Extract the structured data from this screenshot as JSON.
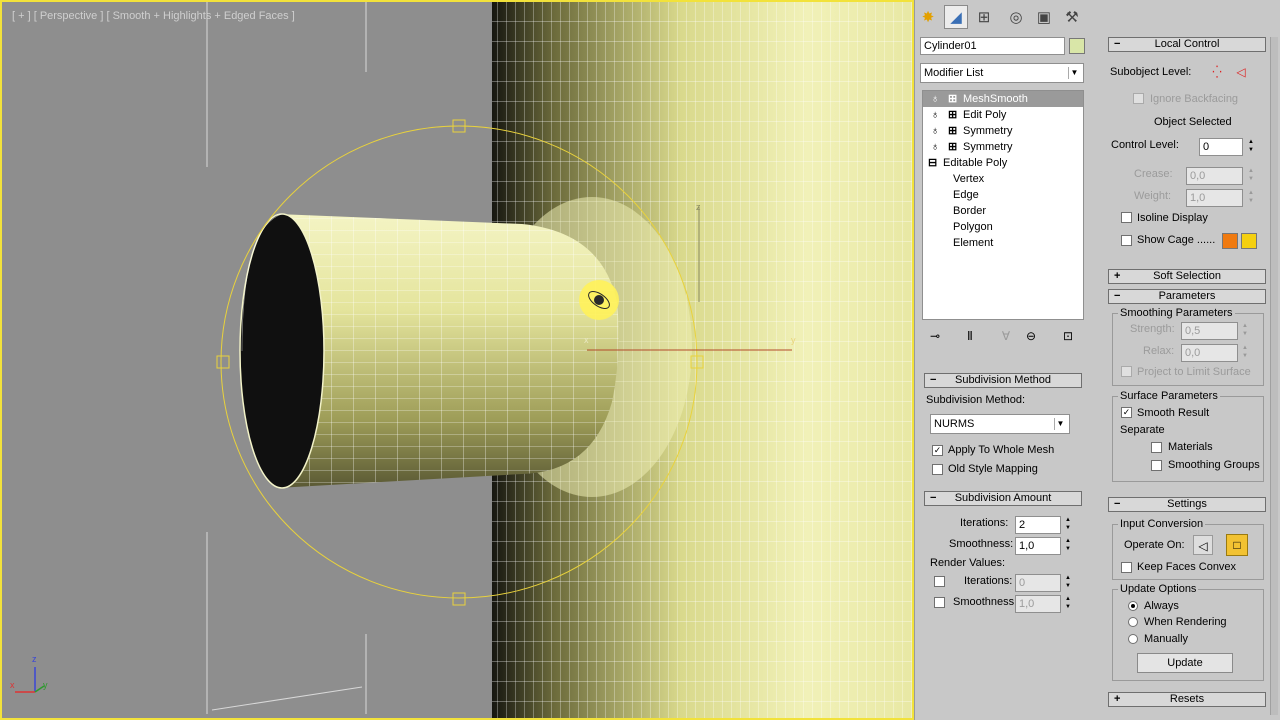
{
  "viewport": {
    "label": "[ + ] [ Perspective ] [ Smooth + Highlights + Edged Faces ]",
    "axis_y": "y",
    "axis_x": "x",
    "axis_z": "z",
    "triad": {
      "z": "z",
      "x": "x",
      "y": "y"
    }
  },
  "toolbar": {
    "tabs": [
      {
        "name": "create-icon",
        "glyph": "✸"
      },
      {
        "name": "modify-icon",
        "glyph": "◢"
      },
      {
        "name": "hierarchy-icon",
        "glyph": "⊞"
      },
      {
        "name": "motion-icon",
        "glyph": "◎"
      },
      {
        "name": "display-icon",
        "glyph": "▣"
      },
      {
        "name": "utilities-icon",
        "glyph": "⚒"
      }
    ]
  },
  "object": {
    "name": "Cylinder01",
    "color": "#d9e6a8"
  },
  "modifier_list": {
    "label": "Modifier List"
  },
  "stack": {
    "items": [
      {
        "label": "MeshSmooth",
        "selected": true
      },
      {
        "label": "Edit Poly"
      },
      {
        "label": "Symmetry"
      },
      {
        "label": "Symmetry"
      },
      {
        "label": "Editable Poly"
      }
    ],
    "sub_items": [
      "Vertex",
      "Edge",
      "Border",
      "Polygon",
      "Element"
    ]
  },
  "subdivision_method": {
    "header": "Subdivision Method",
    "label": "Subdivision Method:",
    "value": "NURMS",
    "apply_whole_mesh": "Apply To Whole Mesh",
    "old_style_mapping": "Old Style Mapping"
  },
  "subdivision_amount": {
    "header": "Subdivision Amount",
    "iterations_label": "Iterations:",
    "iterations": "2",
    "smoothness_label": "Smoothness:",
    "smoothness": "1,0",
    "render_values": "Render Values:",
    "r_iterations_label": "Iterations:",
    "r_iterations": "0",
    "r_smoothness_label": "Smoothness:",
    "r_smoothness": "1,0"
  },
  "local_control": {
    "header": "Local Control",
    "subobject_level": "Subobject Level:",
    "ignore_backfacing": "Ignore Backfacing",
    "object_selected": "Object Selected",
    "control_level_label": "Control Level:",
    "control_level": "0",
    "crease_label": "Crease:",
    "crease": "0,0",
    "weight_label": "Weight:",
    "weight": "1,0",
    "isoline_display": "Isoline Display",
    "show_cage": "Show Cage ......",
    "cage_color1": "#f07a10",
    "cage_color2": "#f5d010"
  },
  "soft_selection": {
    "header": "Soft Selection"
  },
  "parameters": {
    "header": "Parameters",
    "smoothing_parameters": "Smoothing Parameters",
    "strength_label": "Strength:",
    "strength": "0,5",
    "relax_label": "Relax:",
    "relax": "0,0",
    "project_limit": "Project to Limit Surface",
    "surface_parameters": "Surface Parameters",
    "smooth_result": "Smooth Result",
    "separate": "Separate",
    "materials": "Materials",
    "smoothing_groups": "Smoothing Groups"
  },
  "settings": {
    "header": "Settings",
    "input_conversion": "Input Conversion",
    "operate_on": "Operate On:",
    "keep_faces_convex": "Keep Faces Convex",
    "update_options": "Update Options",
    "always": "Always",
    "when_rendering": "When Rendering",
    "manually": "Manually",
    "update_button": "Update"
  },
  "resets": {
    "header": "Resets"
  }
}
